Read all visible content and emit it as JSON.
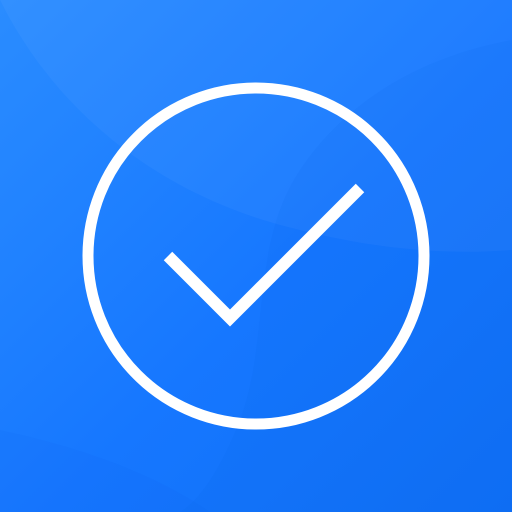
{
  "icon": {
    "semantic": "checkmark-circle-icon",
    "colors": {
      "background_start": "#2a8cff",
      "background_end": "#0f6ff5",
      "foreground": "#ffffff"
    }
  }
}
